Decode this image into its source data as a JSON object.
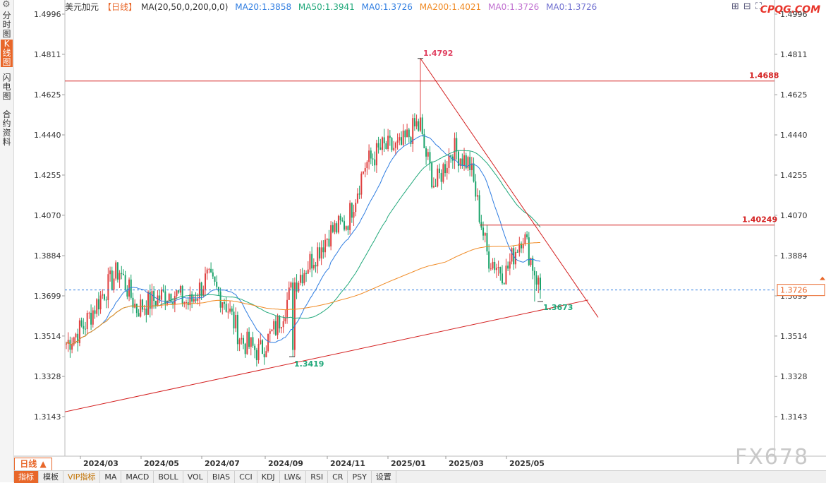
{
  "sidebar": {
    "items": [
      {
        "label": "分时图",
        "active": false
      },
      {
        "label": "K线图",
        "active": true
      },
      {
        "label": "闪电图",
        "active": false
      },
      {
        "label": "合约资料",
        "active": false
      }
    ],
    "settings_icon": "gear-icon"
  },
  "header": {
    "symbol": "美元加元",
    "period": "【日线】",
    "indicator": "MA(20,50,0,200,0,0)",
    "ma_values": [
      {
        "label": "MA20:1.3858",
        "color": "#2f7de1"
      },
      {
        "label": "MA50:1.3941",
        "color": "#20a87a"
      },
      {
        "label": "MA0:1.3726",
        "color": "#2f7de1"
      },
      {
        "label": "MA200:1.4021",
        "color": "#f08a24"
      },
      {
        "label": "MA0:1.3726",
        "color": "#c070d0"
      },
      {
        "label": "MA0:1.3726",
        "color": "#7070d0"
      }
    ]
  },
  "brand": "CPQG.COM",
  "watermark": "FX678",
  "top_icons": [
    "grid-icon",
    "grid-icon",
    "expand-icon"
  ],
  "period_button": "日线 ▲",
  "toolbar": [
    "指标",
    "模板",
    "VIP指标",
    "MA",
    "MACD",
    "BOLL",
    "VOL",
    "BIAS",
    "CCI",
    "KDJ",
    "LW&",
    "RSI",
    "CR",
    "PSY",
    "设置"
  ],
  "colors": {
    "up": "#e04040",
    "down": "#1aa36a",
    "ma20": "#2f7de1",
    "ma50": "#20a87a",
    "ma200": "#f08a24",
    "trendline": "#d42020",
    "current_price": "#2f7de1",
    "accent": "#e8672a"
  },
  "chart_data": {
    "type": "candlestick",
    "y_ticks": [
      "1.4996",
      "1.4811",
      "1.4625",
      "1.4440",
      "1.4255",
      "1.4070",
      "1.3884",
      "1.3699",
      "1.3514",
      "1.3328",
      "1.3143"
    ],
    "x_ticks": [
      "2024/03",
      "2024/05",
      "2024/07",
      "2024/09",
      "2024/11",
      "2025/01",
      "2025/03",
      "2025/05"
    ],
    "ylim": [
      1.3143,
      1.4996
    ],
    "current_price": "1.3726",
    "annotations": {
      "high": "1.4792",
      "low_sep": "1.3419",
      "recent_low": "1.3673",
      "resistance_1": "1.4688",
      "resistance_2": "1.40249"
    },
    "horizontal_levels": [
      1.4688,
      1.40249
    ],
    "trendlines": [
      {
        "name": "support",
        "from": [
          "2024/02",
          1.3165
        ],
        "to": [
          "2025/05",
          1.368
        ]
      },
      {
        "name": "resistance",
        "from": [
          "2025/02",
          1.4792
        ],
        "to": [
          "2025/05",
          1.36
        ]
      }
    ],
    "close_path": [
      [
        "2024/02",
        1.348
      ],
      [
        "2024/03",
        1.356
      ],
      [
        "2024/04",
        1.37
      ],
      [
        "2024/04b",
        1.382
      ],
      [
        "2024/05",
        1.364
      ],
      [
        "2024/06",
        1.368
      ],
      [
        "2024/06b",
        1.372
      ],
      [
        "2024/07",
        1.366
      ],
      [
        "2024/07b",
        1.378
      ],
      [
        "2024/08",
        1.368
      ],
      [
        "2024/08b",
        1.349
      ],
      [
        "2024/09",
        1.344
      ],
      [
        "2024/09b",
        1.356
      ],
      [
        "2024/10",
        1.376
      ],
      [
        "2024/10b",
        1.387
      ],
      [
        "2024/11",
        1.399
      ],
      [
        "2024/11b",
        1.404
      ],
      [
        "2024/12",
        1.43
      ],
      [
        "2024/12b",
        1.438
      ],
      [
        "2025/01",
        1.438
      ],
      [
        "2025/02",
        1.449
      ],
      [
        "2025/02b",
        1.42
      ],
      [
        "2025/03",
        1.438
      ],
      [
        "2025/03b",
        1.43
      ],
      [
        "2025/04",
        1.388
      ],
      [
        "2025/04b",
        1.38
      ],
      [
        "2025/05",
        1.399
      ],
      [
        "2025/05b",
        1.3726
      ]
    ]
  }
}
